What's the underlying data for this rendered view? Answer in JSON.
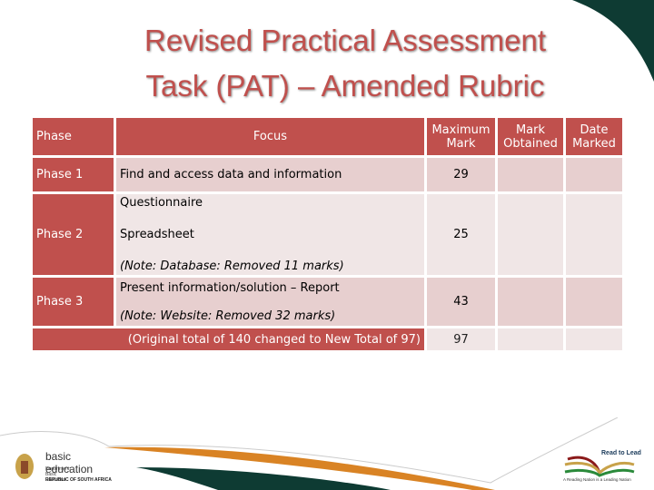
{
  "title": {
    "line1": "Revised  Practical Assessment",
    "line2": "Task (PAT) – Amended Rubric"
  },
  "table": {
    "headers": [
      "Phase",
      "Focus",
      "Maximum Mark",
      "Mark Obtained",
      "Date Marked"
    ],
    "rows": [
      {
        "phase": "Phase 1",
        "focus": [
          "Find and access data and information"
        ],
        "note": "",
        "max": "29"
      },
      {
        "phase": "Phase 2",
        "focus": [
          "Questionnaire",
          "Spreadsheet"
        ],
        "note": "(Note: Database:  Removed 11 marks)",
        "max": "25"
      },
      {
        "phase": "Phase 3",
        "focus": [
          "Present information/solution – Report"
        ],
        "note": "(Note: Website: Removed 32 marks)",
        "max": "43"
      }
    ],
    "total": {
      "label": "(Original total of 140 changed to New Total of 97)",
      "max": "97"
    }
  },
  "footer": {
    "left_logo": {
      "name": "basic education",
      "line1": "Department:",
      "line2": "Basic Education",
      "line3": "REPUBLIC OF SOUTH AFRICA"
    },
    "right_logo": {
      "name": "Read to Lead",
      "tagline": "A Reading Nation is a Leading Nation"
    }
  },
  "colors": {
    "accent": "#c0504d",
    "row_dark": "#e7cfcf",
    "row_light": "#f0e6e6",
    "green": "#0e3b33",
    "orange": "#d98324"
  }
}
